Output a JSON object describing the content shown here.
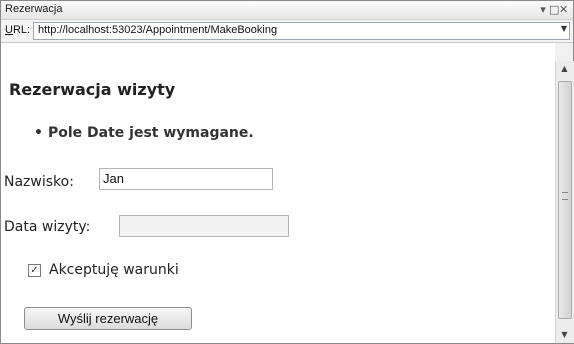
{
  "window": {
    "title": "Rezerwacja",
    "controls": [
      "▾",
      "□",
      "✕"
    ]
  },
  "urlbar": {
    "label_underlined": "U",
    "label_rest": "RL:",
    "url": "http://localhost:53023/Appointment/MakeBooking"
  },
  "page": {
    "heading": "Rezerwacja wizyty",
    "errors": [
      "Pole Date jest wymagane."
    ],
    "name_label": "Nazwisko:",
    "name_value": "Jan",
    "date_label": "Data wizyty:",
    "date_value": "",
    "terms_label": "Akceptuję warunki",
    "terms_checked": true,
    "submit_label": "Wyślij rezerwację"
  },
  "icons": {
    "checkbox": "checkmark-icon",
    "url_dropdown": "chevron-down-icon",
    "scroll_up": "arrow-up-icon",
    "scroll_down": "arrow-down-icon"
  }
}
